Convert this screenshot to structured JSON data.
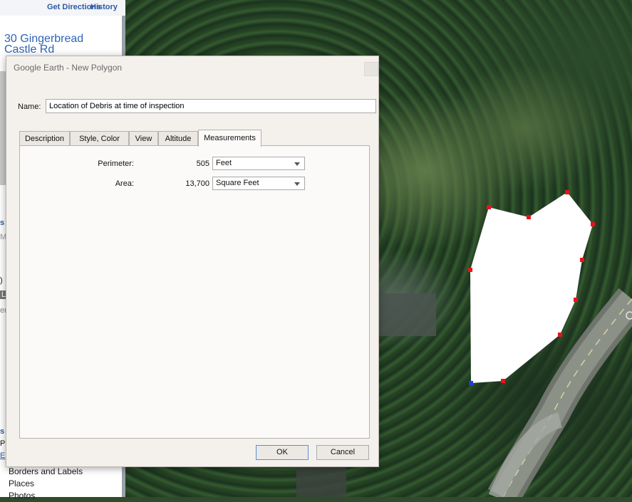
{
  "left_panel": {
    "header": {
      "get_directions": "Get Directions",
      "history": "History"
    },
    "search_result": "30 Gingerbread Castle Rd",
    "fragments": [
      "s",
      "My",
      "S",
      ")",
      "L",
      "en",
      "s",
      "Pri",
      "E"
    ],
    "layers": [
      "Borders and Labels",
      "Places",
      "Photos"
    ]
  },
  "dialog": {
    "title": "Google Earth - New Polygon",
    "name_label": "Name:",
    "name_value": "Location of Debris at time of inspection",
    "tabs": [
      "Description",
      "Style, Color",
      "View",
      "Altitude",
      "Measurements"
    ],
    "active_tab": "Measurements",
    "measurements": {
      "perimeter_label": "Perimeter:",
      "perimeter_value": "505",
      "perimeter_unit": "Feet",
      "area_label": "Area:",
      "area_value": "13,700",
      "area_unit": "Square Feet"
    },
    "ok_label": "OK",
    "cancel_label": "Cancel"
  },
  "map": {
    "polygon_fill": "#ffffff",
    "vertex_color": "#e8141c",
    "selected_vertex_color": "#1f3fd6",
    "road_color": "#8b9187"
  }
}
